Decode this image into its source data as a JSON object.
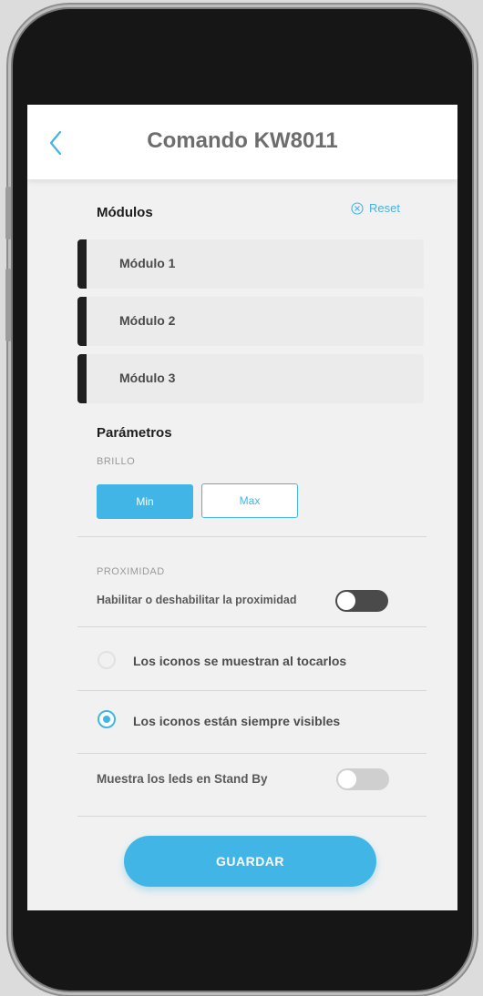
{
  "header": {
    "title": "Comando KW8011",
    "back_icon": "chevron-left-icon"
  },
  "modules": {
    "title": "Módulos",
    "reset_label": "Reset",
    "reset_icon": "close-circle-icon",
    "items": [
      {
        "label": "Módulo 1"
      },
      {
        "label": "Módulo 2"
      },
      {
        "label": "Módulo 3"
      }
    ]
  },
  "parameters": {
    "title": "Parámetros",
    "brightness": {
      "label": "BRILLO",
      "min_label": "Min",
      "max_label": "Max",
      "selected": "Min"
    },
    "proximity": {
      "label": "PROXIMIDAD",
      "toggle_label": "Habilitar o deshabilitar la proximidad",
      "enabled": false
    },
    "icons": {
      "options": [
        {
          "label": "Los iconos se muestran al tocarlos",
          "selected": false
        },
        {
          "label": "Los iconos están siempre visibles",
          "selected": true
        }
      ]
    },
    "standby": {
      "label": "Muestra los leds en Stand By",
      "enabled": false
    }
  },
  "actions": {
    "save_label": "GUARDAR"
  },
  "colors": {
    "accent": "#41b6e6",
    "module_bar": "#1f1f1f",
    "toggle_dark": "#4a4a4a",
    "toggle_light": "#cfcfcf"
  }
}
